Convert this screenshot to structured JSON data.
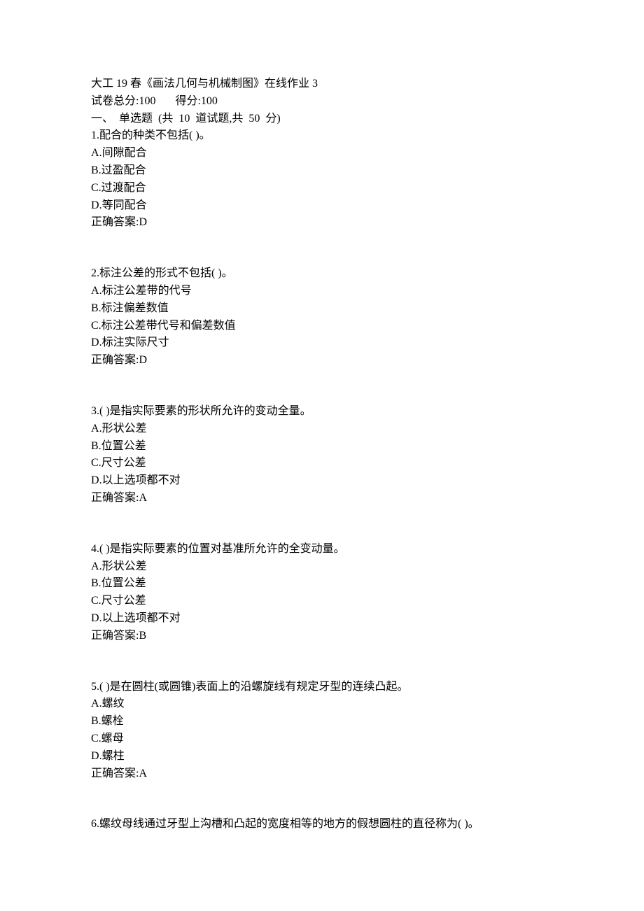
{
  "header": {
    "title": "大工 19 春《画法几何与机械制图》在线作业 3",
    "score_line": "试卷总分:100       得分:100",
    "section_line": "一、  单选题  (共  10  道试题,共  50  分)"
  },
  "questions": [
    {
      "number": "1",
      "stem": "配合的种类不包括( )。",
      "options": [
        {
          "letter": "A",
          "text": "间隙配合"
        },
        {
          "letter": "B",
          "text": "过盈配合"
        },
        {
          "letter": "C",
          "text": "过渡配合"
        },
        {
          "letter": "D",
          "text": "等同配合"
        }
      ],
      "answer_label": "正确答案:",
      "answer": "D"
    },
    {
      "number": "2",
      "stem": "标注公差的形式不包括( )。",
      "options": [
        {
          "letter": "A",
          "text": "标注公差带的代号"
        },
        {
          "letter": "B",
          "text": "标注偏差数值"
        },
        {
          "letter": "C",
          "text": "标注公差带代号和偏差数值"
        },
        {
          "letter": "D",
          "text": "标注实际尺寸"
        }
      ],
      "answer_label": "正确答案:",
      "answer": "D"
    },
    {
      "number": "3",
      "stem": "( )是指实际要素的形状所允许的变动全量。",
      "options": [
        {
          "letter": "A",
          "text": "形状公差"
        },
        {
          "letter": "B",
          "text": "位置公差"
        },
        {
          "letter": "C",
          "text": "尺寸公差"
        },
        {
          "letter": "D",
          "text": "以上选项都不对"
        }
      ],
      "answer_label": "正确答案:",
      "answer": "A"
    },
    {
      "number": "4",
      "stem": "( )是指实际要素的位置对基准所允许的全变动量。",
      "options": [
        {
          "letter": "A",
          "text": "形状公差"
        },
        {
          "letter": "B",
          "text": "位置公差"
        },
        {
          "letter": "C",
          "text": "尺寸公差"
        },
        {
          "letter": "D",
          "text": "以上选项都不对"
        }
      ],
      "answer_label": "正确答案:",
      "answer": "B"
    },
    {
      "number": "5",
      "stem": "( )是在圆柱(或圆锥)表面上的沿螺旋线有规定牙型的连续凸起。",
      "options": [
        {
          "letter": "A",
          "text": "螺纹"
        },
        {
          "letter": "B",
          "text": "螺栓"
        },
        {
          "letter": "C",
          "text": "螺母"
        },
        {
          "letter": "D",
          "text": "螺柱"
        }
      ],
      "answer_label": "正确答案:",
      "answer": "A"
    },
    {
      "number": "6",
      "stem": "螺纹母线通过牙型上沟槽和凸起的宽度相等的地方的假想圆柱的直径称为( )。",
      "options": [],
      "answer_label": "",
      "answer": ""
    }
  ]
}
